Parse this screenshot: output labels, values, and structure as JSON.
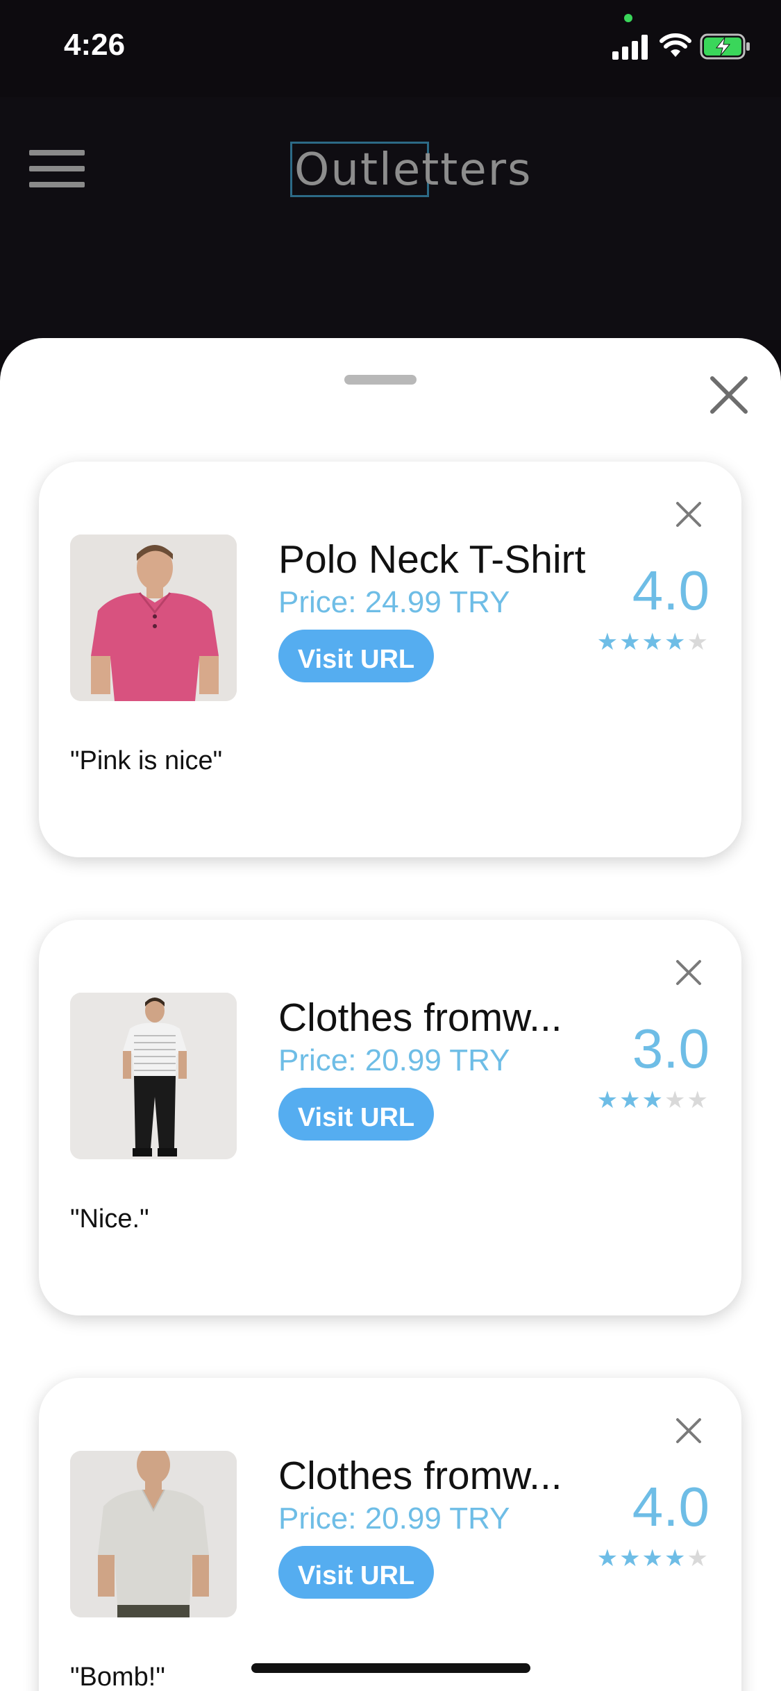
{
  "status_bar": {
    "time": "4:26"
  },
  "header": {
    "logo_text": "Outletters"
  },
  "sheet": {
    "items": [
      {
        "title": "Polo Neck T-Shirt",
        "price": "Price: 24.99 TRY",
        "button_label": "Visit URL",
        "rating": "4.0",
        "stars": 4,
        "comment": "\"Pink is nice\"",
        "image_icon": "pink-polo-shirt-photo",
        "shirt_color": "#d8527f",
        "pants_color": "#3a3a3a"
      },
      {
        "title": "Clothes fromw...",
        "price": "Price: 20.99 TRY",
        "button_label": "Visit URL",
        "rating": "3.0",
        "stars": 3,
        "comment": "\"Nice.\"",
        "image_icon": "striped-tee-joggers-photo",
        "shirt_color": "#eeeeee",
        "pants_color": "#1a1a1a"
      },
      {
        "title": "Clothes fromw...",
        "price": "Price: 20.99 TRY",
        "button_label": "Visit URL",
        "rating": "4.0",
        "stars": 4,
        "comment": "\"Bomb!\"",
        "image_icon": "grey-vneck-tee-photo",
        "shirt_color": "#d9d8d3",
        "pants_color": "#4a4a3e"
      }
    ]
  },
  "colors": {
    "accent": "#6ebde6",
    "button": "#55adf0",
    "header_bg": "#0f0d12"
  }
}
